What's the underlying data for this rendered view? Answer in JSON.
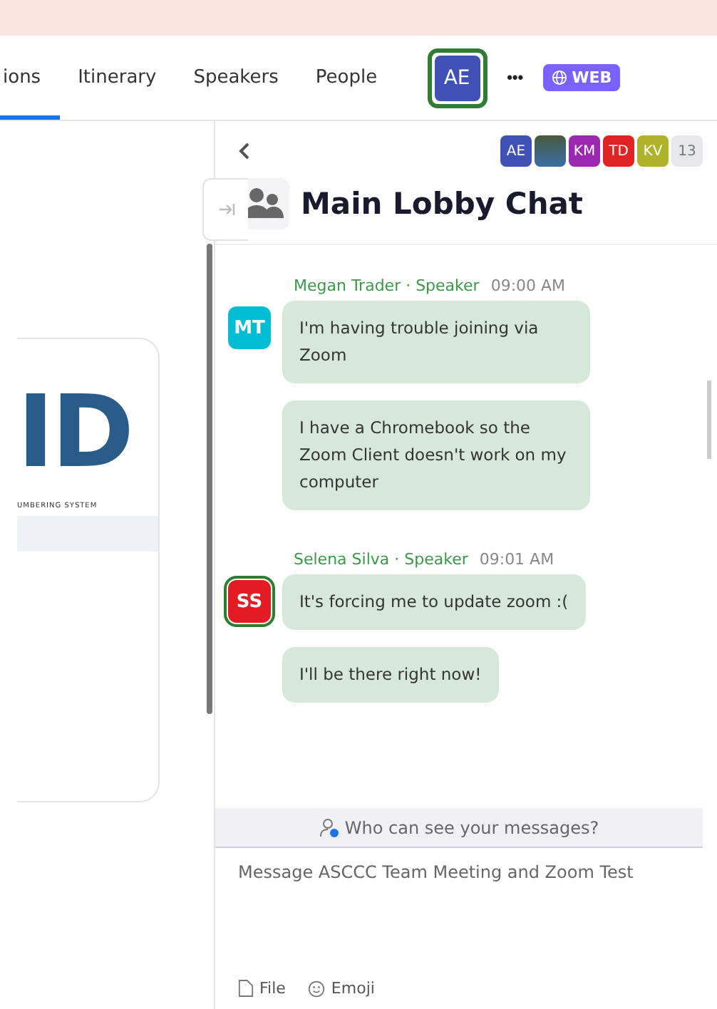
{
  "tabs": [
    {
      "label": "ions",
      "selected": true
    },
    {
      "label": "Itinerary",
      "selected": false
    },
    {
      "label": "Speakers",
      "selected": false
    },
    {
      "label": "People",
      "selected": false
    }
  ],
  "profile": {
    "initials": "AE"
  },
  "more": "•••",
  "badge": {
    "label": "WEB"
  },
  "left_card": {
    "logo": "ID",
    "tagline": "UMBERING SYSTEM"
  },
  "participants": [
    {
      "kind": "initials",
      "initials": "AE",
      "color": "#3f51b5"
    },
    {
      "kind": "photo"
    },
    {
      "kind": "initials",
      "initials": "KM",
      "color": "#9c27b0"
    },
    {
      "kind": "initials",
      "initials": "TD",
      "color": "#e02424"
    },
    {
      "kind": "initials",
      "initials": "KV",
      "color": "#afb42b"
    }
  ],
  "participant_count": "13",
  "chat": {
    "title": "Main Lobby Chat",
    "groups": [
      {
        "sender": "Megan Trader · Speaker",
        "time": "09:00 AM",
        "initials": "MT",
        "color": "#00bcd4",
        "ringed": false,
        "messages": [
          "I'm having trouble joining via Zoom",
          "I have a Chromebook so the Zoom Client doesn't work on my computer"
        ]
      },
      {
        "sender": "Selena Silva · Speaker",
        "time": "09:01 AM",
        "initials": "SS",
        "color": "#e31b23",
        "ringed": true,
        "messages": [
          "It's forcing me to update zoom :(",
          "I'll be there right now!"
        ]
      }
    ],
    "privacy_notice": "Who can see your messages?",
    "input": {
      "placeholder": "Message ASCCC Team Meeting and Zoom Test"
    },
    "actions": [
      "File",
      "Emoji"
    ]
  }
}
